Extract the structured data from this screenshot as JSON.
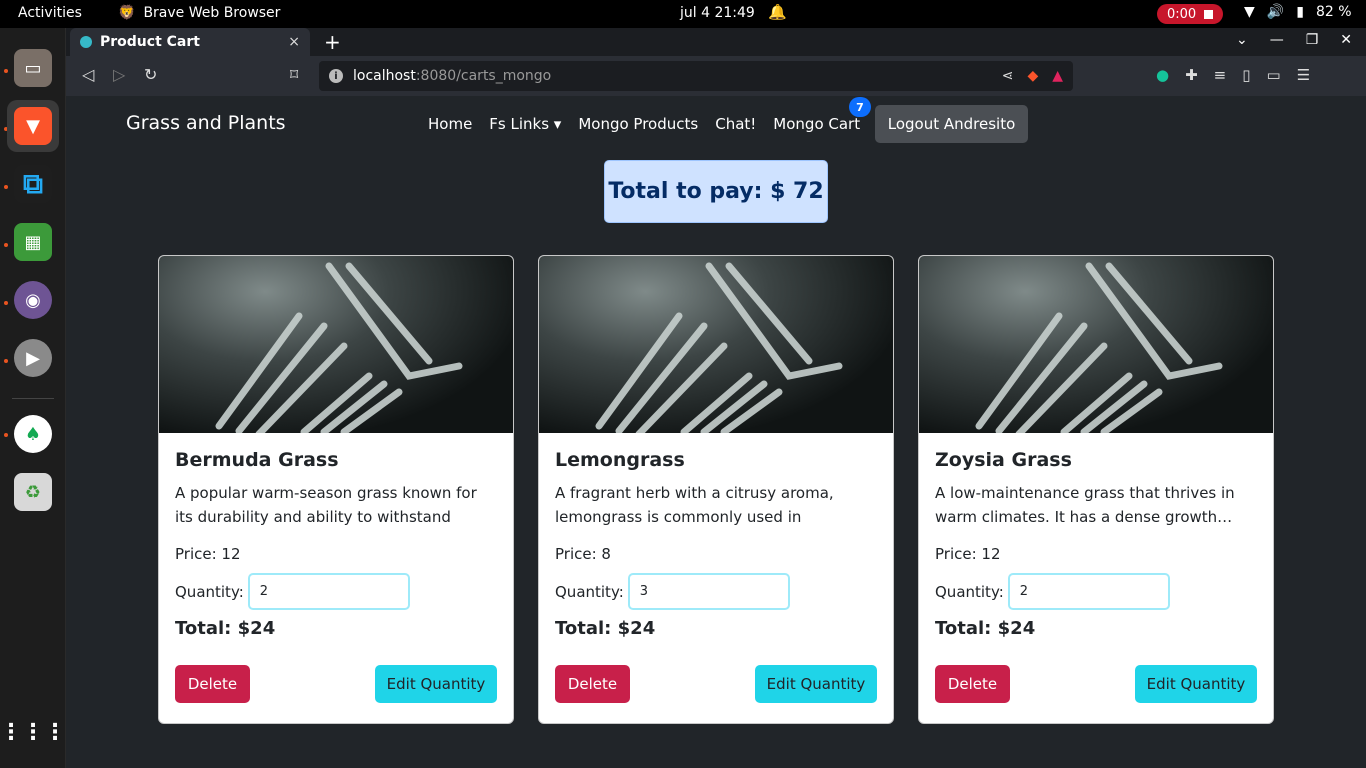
{
  "topbar": {
    "activities": "Activities",
    "app_name": "Brave Web Browser",
    "clock": "jul 4  21:49",
    "recording": "0:00",
    "battery": "82 %"
  },
  "browser": {
    "tab_title": "Product Cart",
    "tab_close": "×",
    "new_tab": "+",
    "url_host": "localhost",
    "url_path": ":8080/carts_mongo"
  },
  "navbar": {
    "brand": "Grass and Plants",
    "links": [
      "Home",
      "Fs Links ▾",
      "Mongo Products",
      "Chat!",
      "Mongo Cart"
    ],
    "cart_badge": "7",
    "logout": "Logout Andresito"
  },
  "summary": {
    "total_to_pay": "Total to pay: $ 72"
  },
  "cards": [
    {
      "title": "Bermuda Grass",
      "description": "A popular warm-season grass known for its durability and ability to withstand heavy…",
      "price": "Price: 12",
      "quantity_label": "Quantity:",
      "quantity": "2",
      "total": "Total: $24",
      "delete": "Delete",
      "edit": "Edit Quantity"
    },
    {
      "title": "Lemongrass",
      "description": "A fragrant herb with a citrusy aroma, lemongrass is commonly used in cooking…",
      "price": "Price: 8",
      "quantity_label": "Quantity:",
      "quantity": "3",
      "total": "Total: $24",
      "delete": "Delete",
      "edit": "Edit Quantity"
    },
    {
      "title": "Zoysia Grass",
      "description": "A low-maintenance grass that thrives in warm climates. It has a dense growth…",
      "price": "Price: 12",
      "quantity_label": "Quantity:",
      "quantity": "2",
      "total": "Total: $24",
      "delete": "Delete",
      "edit": "Edit Quantity"
    }
  ],
  "colors": {
    "page_bg": "#212529",
    "delete": "#c8204a",
    "edit": "#1fd4e8",
    "total_box": "#cfe2ff",
    "badge": "#0d6efd"
  }
}
